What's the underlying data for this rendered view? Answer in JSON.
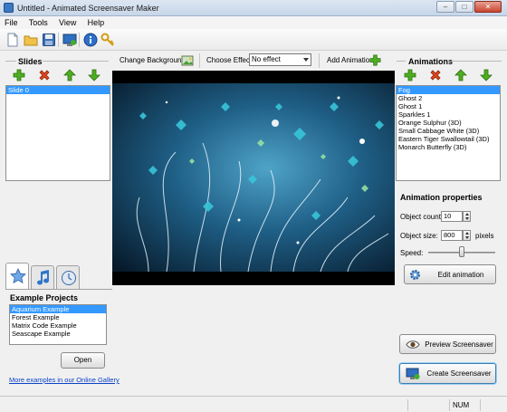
{
  "window": {
    "title": "Untitled - Animated Screensaver Maker"
  },
  "menu": [
    "File",
    "Tools",
    "View",
    "Help"
  ],
  "effect_bar": {
    "change_background_label": "Change Background",
    "choose_effect_label": "Choose Effect:",
    "effect_value": "No effect",
    "add_animation_label": "Add Animation"
  },
  "slides": {
    "title": "Slides",
    "items": [
      "Slide 0"
    ]
  },
  "animations": {
    "title": "Animations",
    "items": [
      "Fog",
      "Ghost 2",
      "Ghost 1",
      "Sparkles 1",
      "Orange Sulphur (3D)",
      "Small Cabbage White (3D)",
      "Eastern Tiger Swallowtail (3D)",
      "Monarch Butterfly (3D)"
    ]
  },
  "properties": {
    "title": "Animation properties",
    "count_label": "Object count:",
    "count_value": "10",
    "size_label": "Object size:",
    "size_value": "800",
    "size_unit": "pixels",
    "speed_label": "Speed:",
    "speed_level": 0.5,
    "edit_label": "Edit animation"
  },
  "projects": {
    "title": "Example Projects",
    "items": [
      "Aquarium Example",
      "Forest Example",
      "Matrix Code Example",
      "Seascape Example"
    ],
    "open_label": "Open",
    "gallery_link": "More examples in our Online Gallery"
  },
  "actions": {
    "preview_label": "Preview Screensaver",
    "create_label": "Create Screensaver"
  },
  "status": {
    "num": "NUM"
  },
  "colors": {
    "selection": "#3399ff",
    "accent_green": "#4caf1e",
    "accent_red": "#e0451c"
  }
}
